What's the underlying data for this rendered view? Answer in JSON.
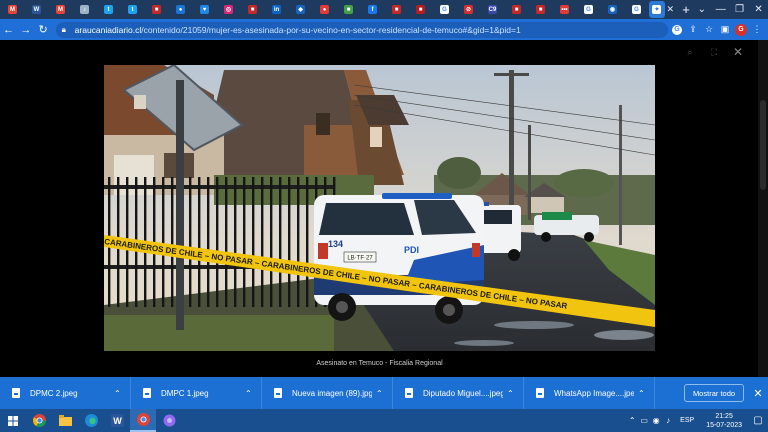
{
  "browser": {
    "tabs": [
      {
        "icon": "gmail-icon",
        "color": "#ea4335",
        "glyph": "M"
      },
      {
        "icon": "word-doc-icon",
        "color": "#2b579a",
        "glyph": "W"
      },
      {
        "icon": "gmail-icon",
        "color": "#ea4335",
        "glyph": "M"
      },
      {
        "icon": "audio-icon",
        "color": "#9fb3c8",
        "glyph": "♪"
      },
      {
        "icon": "twitter-icon",
        "color": "#1da1f2",
        "glyph": "t"
      },
      {
        "icon": "twitter-icon",
        "color": "#1da1f2",
        "glyph": "t"
      },
      {
        "icon": "red-site-icon",
        "color": "#c62828",
        "glyph": "■"
      },
      {
        "icon": "blue-site-icon",
        "color": "#1976d2",
        "glyph": "●"
      },
      {
        "icon": "heart-site-icon",
        "color": "#1e88e5",
        "glyph": "♥"
      },
      {
        "icon": "instagram-icon",
        "color": "#d62976",
        "glyph": "◎"
      },
      {
        "icon": "news-site-icon",
        "color": "#c62828",
        "glyph": "■"
      },
      {
        "icon": "linkedin-icon",
        "color": "#0a66c2",
        "glyph": "in"
      },
      {
        "icon": "blue-site-icon",
        "color": "#1565c0",
        "glyph": "◆"
      },
      {
        "icon": "red-dot-icon",
        "color": "#e53935",
        "glyph": "●"
      },
      {
        "icon": "green-site-icon",
        "color": "#43a047",
        "glyph": "■"
      },
      {
        "icon": "facebook-icon",
        "color": "#1877f2",
        "glyph": "f"
      },
      {
        "icon": "news-site-icon",
        "color": "#c62828",
        "glyph": "■"
      },
      {
        "icon": "news-site-icon",
        "color": "#b71c1c",
        "glyph": "■"
      },
      {
        "icon": "google-icon",
        "color": "#ffffff",
        "glyph": "G"
      },
      {
        "icon": "red-circle-icon",
        "color": "#d32f2f",
        "glyph": "⊘"
      },
      {
        "icon": "c9-site-icon",
        "color": "#3949ab",
        "glyph": "C9"
      },
      {
        "icon": "news-site-icon",
        "color": "#c62828",
        "glyph": "■"
      },
      {
        "icon": "news-site-icon",
        "color": "#c62828",
        "glyph": "■"
      },
      {
        "icon": "dots-site-icon",
        "color": "#e53935",
        "glyph": "•••"
      },
      {
        "icon": "google-icon",
        "color": "#ffffff",
        "glyph": "G"
      },
      {
        "icon": "blue-site-icon",
        "color": "#1565c0",
        "glyph": "◉"
      },
      {
        "icon": "google-icon",
        "color": "#ffffff",
        "glyph": "G"
      }
    ],
    "active_tab": {
      "icon": "active-tab-icon",
      "glyph": "✦"
    },
    "url_host": "araucaniadiario.cl",
    "url_path": "/contenido/21059/mujer-es-asesinada-por-su-vecino-en-sector-residencial-de-temuco#&gid=1&pid=1",
    "profile_initial": "G"
  },
  "viewer": {
    "caption": "Asesinato en Temuco - Fiscalia Regional",
    "photo": {
      "vehicle_unit": "134",
      "vehicle_agency": "PDI",
      "plate": "LB·TF·27",
      "tape_text": "CARABINEROS DE CHILE – NO PASAR – CARABINEROS DE CHILE – NO PASAR – CARABINEROS DE CHILE – NO PASAR"
    }
  },
  "downloads": {
    "items": [
      {
        "name": "DPMC 2.jpeg"
      },
      {
        "name": "DMPC 1.jpeg"
      },
      {
        "name": "Nueva imagen (89).jpg"
      },
      {
        "name": "Diputado Miguel....jpeg"
      },
      {
        "name": "WhatsApp Image....jpeg"
      }
    ],
    "show_all": "Mostrar todo"
  },
  "taskbar": {
    "language": "ESP",
    "time": "21:25",
    "date": "15-07-2023"
  }
}
